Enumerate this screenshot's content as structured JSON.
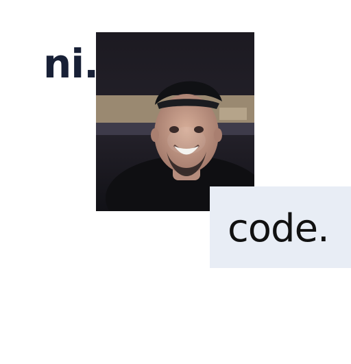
{
  "brand": {
    "prefix_word": "ni.",
    "suffix_word": "code."
  },
  "photo": {
    "subject": "portrait-photo",
    "colors": {
      "background": "#1d1b22",
      "panel": "#b9a98d",
      "cap": "#111114",
      "skin": "#c69a87",
      "shirt": "#0f0f12"
    }
  },
  "theme": {
    "text_dark": "#182036",
    "code_panel": "#e8edf5"
  }
}
